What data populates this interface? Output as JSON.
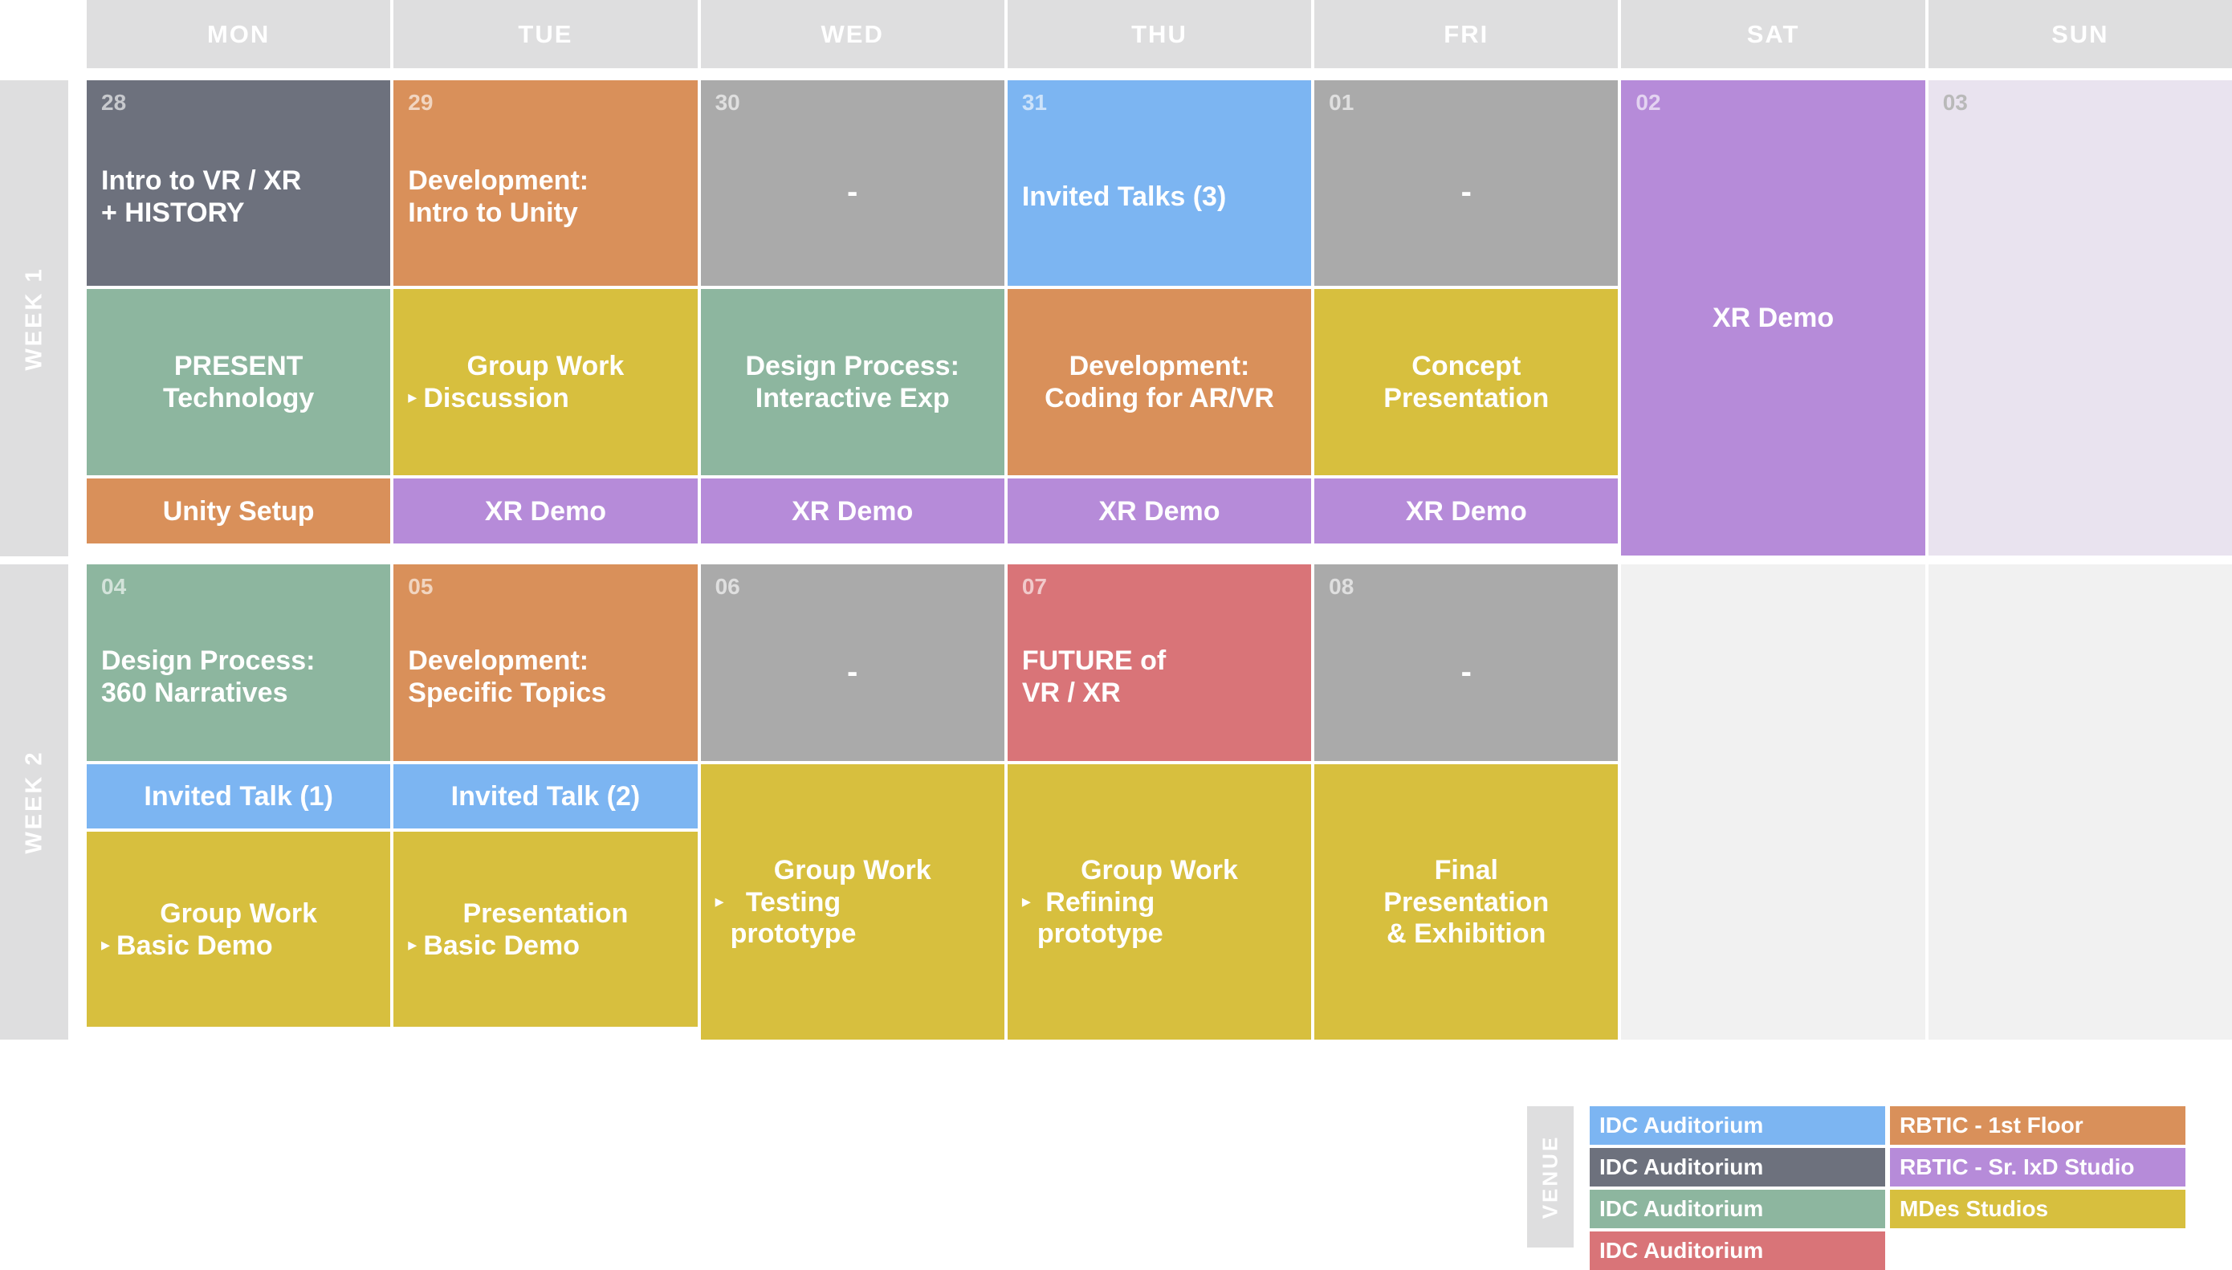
{
  "header": {
    "days": [
      "MON",
      "TUE",
      "WED",
      "THU",
      "FRI",
      "SAT",
      "SUN"
    ]
  },
  "colors": {
    "header_gray": "#dededf",
    "slate": "#6d717d",
    "orange": "#d9905a",
    "gray": "#aaaaaa",
    "blue": "#7cb5f2",
    "green": "#8db69f",
    "yellow": "#d7bf3e",
    "purple": "#b68bd9",
    "red": "#d97478",
    "lavender_faint": "#e9e3ef",
    "empty_gray": "#f1f1f1"
  },
  "weeks": [
    {
      "label": "WEEK 1",
      "columns": [
        {
          "day": "MON",
          "cells": [
            {
              "daynum": "28",
              "title": "Intro to VR / XR\n+ HISTORY",
              "color": "#6d717d",
              "row": "r1"
            },
            {
              "daynum": "",
              "title": "PRESENT\nTechnology",
              "color": "#8db69f",
              "row": "r2"
            },
            {
              "daynum": "",
              "title": "Unity Setup",
              "color": "#d9905a",
              "row": "r3"
            }
          ]
        },
        {
          "day": "TUE",
          "cells": [
            {
              "daynum": "29",
              "title": "Development:\nIntro to Unity",
              "color": "#d9905a",
              "row": "r1"
            },
            {
              "daynum": "",
              "title": "Group Work",
              "subtitle": "Discussion",
              "color": "#d7bf3e",
              "row": "r2"
            },
            {
              "daynum": "",
              "title": "XR Demo",
              "color": "#b68bd9",
              "row": "r3"
            }
          ]
        },
        {
          "day": "WED",
          "cells": [
            {
              "daynum": "30",
              "title": "",
              "dash": "-",
              "color": "#aaaaaa",
              "row": "r1"
            },
            {
              "daynum": "",
              "title": "Design Process:\nInteractive Exp",
              "color": "#8db69f",
              "row": "r2"
            },
            {
              "daynum": "",
              "title": "XR Demo",
              "color": "#b68bd9",
              "row": "r3"
            }
          ]
        },
        {
          "day": "THU",
          "cells": [
            {
              "daynum": "31",
              "title": "Invited Talks (3)",
              "color": "#7cb5f2",
              "row": "r1"
            },
            {
              "daynum": "",
              "title": "Development:\nCoding for AR/VR",
              "color": "#d9905a",
              "row": "r2"
            },
            {
              "daynum": "",
              "title": "XR Demo",
              "color": "#b68bd9",
              "row": "r3"
            }
          ]
        },
        {
          "day": "FRI",
          "cells": [
            {
              "daynum": "01",
              "title": "",
              "dash": "-",
              "color": "#aaaaaa",
              "row": "r1"
            },
            {
              "daynum": "",
              "title": "Concept\nPresentation",
              "color": "#d7bf3e",
              "row": "r2"
            },
            {
              "daynum": "",
              "title": "XR Demo",
              "color": "#b68bd9",
              "row": "r3"
            }
          ]
        },
        {
          "day": "SAT",
          "full": {
            "daynum": "02",
            "title": "XR Demo",
            "color": "#b68bd9"
          }
        },
        {
          "day": "SUN",
          "full": {
            "daynum": "03",
            "title": "",
            "color": "#e9e3ef",
            "light": true
          }
        }
      ]
    },
    {
      "label": "WEEK 2",
      "columns": [
        {
          "day": "MON",
          "cells": [
            {
              "daynum": "04",
              "title": "Design Process:\n360 Narratives",
              "color": "#8db69f",
              "row": "q1"
            },
            {
              "daynum": "",
              "title": "Invited Talk (1)",
              "color": "#7cb5f2",
              "row": "q2"
            },
            {
              "daynum": "",
              "title": "Group Work",
              "subtitle": "Basic Demo",
              "color": "#d7bf3e",
              "row": "q3"
            }
          ]
        },
        {
          "day": "TUE",
          "cells": [
            {
              "daynum": "05",
              "title": "Development:\nSpecific Topics",
              "color": "#d9905a",
              "row": "q1"
            },
            {
              "daynum": "",
              "title": "Invited Talk (2)",
              "color": "#7cb5f2",
              "row": "q2"
            },
            {
              "daynum": "",
              "title": "Presentation",
              "subtitle": "Basic Demo",
              "color": "#d7bf3e",
              "row": "q3"
            }
          ]
        },
        {
          "day": "WED",
          "cells": [
            {
              "daynum": "06",
              "title": "",
              "dash": "-",
              "color": "#aaaaaa",
              "row": "q1"
            },
            {
              "daynum": "",
              "title": "Group Work",
              "subtitle": "Testing\nprototype",
              "color": "#d7bf3e",
              "row": "merged"
            }
          ]
        },
        {
          "day": "THU",
          "cells": [
            {
              "daynum": "07",
              "title": "FUTURE of\nVR / XR",
              "color": "#d97478",
              "row": "q1"
            },
            {
              "daynum": "",
              "title": "Group Work",
              "subtitle": "Refining\nprototype",
              "color": "#d7bf3e",
              "row": "merged"
            }
          ]
        },
        {
          "day": "FRI",
          "cells": [
            {
              "daynum": "08",
              "title": "",
              "dash": "-",
              "color": "#aaaaaa",
              "row": "q1"
            },
            {
              "daynum": "",
              "title": "Final\nPresentation\n& Exhibition",
              "color": "#d7bf3e",
              "row": "merged"
            }
          ]
        },
        {
          "day": "SAT",
          "full": {
            "daynum": "",
            "title": "",
            "color": "#f1f1f1",
            "light": true
          }
        },
        {
          "day": "SUN",
          "full": {
            "daynum": "",
            "title": "",
            "color": "#f1f1f1",
            "light": true
          }
        }
      ]
    }
  ],
  "legend": {
    "label": "VENUE",
    "columns": [
      [
        {
          "text": "IDC Auditorium",
          "color": "#7cb5f2"
        },
        {
          "text": "IDC Auditorium",
          "color": "#6d717d"
        },
        {
          "text": "IDC Auditorium",
          "color": "#8db69f"
        },
        {
          "text": "IDC Auditorium",
          "color": "#d97478"
        }
      ],
      [
        {
          "text": "RBTIC - 1st Floor",
          "color": "#d9905a"
        },
        {
          "text": "RBTIC - Sr. IxD Studio",
          "color": "#b68bd9"
        },
        {
          "text": "MDes Studios",
          "color": "#d7bf3e"
        },
        {
          "text": "",
          "color": "transparent",
          "blank": true
        }
      ]
    ]
  }
}
